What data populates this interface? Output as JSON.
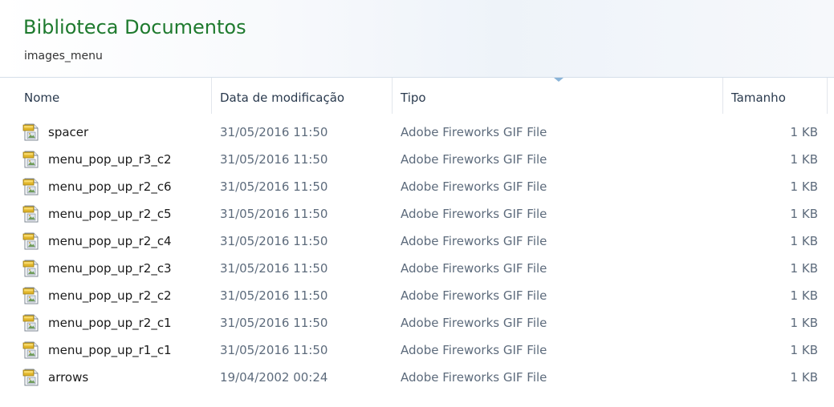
{
  "library": {
    "title": "Biblioteca Documentos",
    "subtitle": "images_menu"
  },
  "columns": {
    "nome": "Nome",
    "data": "Data de modificação",
    "tipo": "Tipo",
    "tamanho": "Tamanho"
  },
  "files": [
    {
      "name": "spacer",
      "date": "31/05/2016 11:50",
      "type": "Adobe Fireworks GIF File",
      "size": "1 KB"
    },
    {
      "name": "menu_pop_up_r3_c2",
      "date": "31/05/2016 11:50",
      "type": "Adobe Fireworks GIF File",
      "size": "1 KB"
    },
    {
      "name": "menu_pop_up_r2_c6",
      "date": "31/05/2016 11:50",
      "type": "Adobe Fireworks GIF File",
      "size": "1 KB"
    },
    {
      "name": "menu_pop_up_r2_c5",
      "date": "31/05/2016 11:50",
      "type": "Adobe Fireworks GIF File",
      "size": "1 KB"
    },
    {
      "name": "menu_pop_up_r2_c4",
      "date": "31/05/2016 11:50",
      "type": "Adobe Fireworks GIF File",
      "size": "1 KB"
    },
    {
      "name": "menu_pop_up_r2_c3",
      "date": "31/05/2016 11:50",
      "type": "Adobe Fireworks GIF File",
      "size": "1 KB"
    },
    {
      "name": "menu_pop_up_r2_c2",
      "date": "31/05/2016 11:50",
      "type": "Adobe Fireworks GIF File",
      "size": "1 KB"
    },
    {
      "name": "menu_pop_up_r2_c1",
      "date": "31/05/2016 11:50",
      "type": "Adobe Fireworks GIF File",
      "size": "1 KB"
    },
    {
      "name": "menu_pop_up_r1_c1",
      "date": "31/05/2016 11:50",
      "type": "Adobe Fireworks GIF File",
      "size": "1 KB"
    },
    {
      "name": "arrows",
      "date": "19/04/2002 00:24",
      "type": "Adobe Fireworks GIF File",
      "size": "1 KB"
    }
  ],
  "icons": {
    "file": "gif-file-icon",
    "sort": "sort-indicator-icon"
  },
  "colors": {
    "title": "#1e7a2e",
    "header_text": "#2a3a4e",
    "muted_text": "#5d6b7c"
  }
}
